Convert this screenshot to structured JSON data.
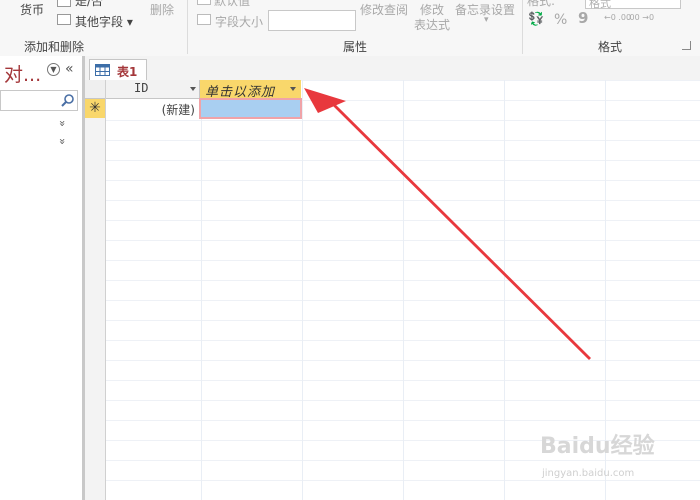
{
  "ribbon": {
    "currency_label": "货币",
    "yesno_label": "是/否",
    "more_fields_label": "其他字段",
    "delete_label": "删除",
    "group_add_delete": "添加和删除",
    "default_value_label": "默认值",
    "field_size_label": "字段大小",
    "field_size_value": "",
    "modify_lookup_label": "修改查阅",
    "modify_expression_label_1": "修改",
    "modify_expression_label_2": "表达式",
    "memo_settings_label": "备忘录设置",
    "group_properties": "属性",
    "data_type_label": "格式:",
    "format_value": "格式",
    "percent_label": "%",
    "comma_label": "9",
    "dec_increase_label": "←0 .00",
    "dec_decrease_label": ".00 →0",
    "group_formatting": "格式"
  },
  "nav": {
    "title": "对...",
    "search_placeholder": ""
  },
  "tab": {
    "label": "表1"
  },
  "sheet": {
    "col_id": "ID",
    "col_add": "单击以添加",
    "new_row_marker": "✳",
    "new_row_text": "(新建)"
  },
  "watermark": {
    "logo": "Baidu经验",
    "url": "jingyan.baidu.com"
  },
  "colors": {
    "accent": "#a4373a",
    "header_highlight": "#f9d76b",
    "selected_cell": "#a9cff1",
    "annotation_arrow": "#e8383d"
  }
}
